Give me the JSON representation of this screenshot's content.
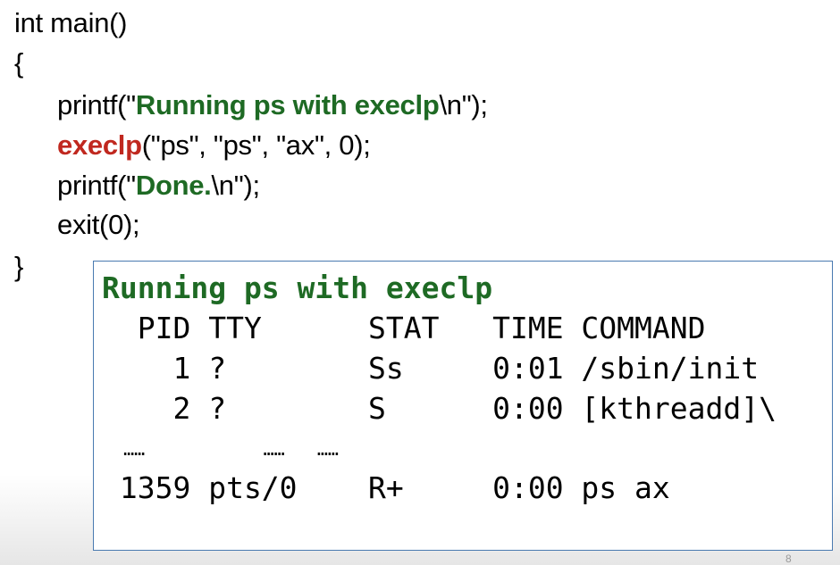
{
  "code": {
    "line1": "int main()",
    "line2": "{",
    "printf1": {
      "prefix": "printf(\"",
      "string": "Running ps with execlp",
      "suffix": "\\n\");"
    },
    "execlp": {
      "keyword": "execlp",
      "args": "(\"ps\", \"ps\", \"ax\", 0);"
    },
    "printf2": {
      "prefix": "printf(\"",
      "string": "Done.",
      "suffix": "\\n\");"
    },
    "exit": "exit(0);",
    "close": "}"
  },
  "terminal": {
    "title": "Running ps with execlp",
    "header": "  PID TTY      STAT   TIME COMMAND",
    "rows": [
      "    1 ?        Ss     0:01 /sbin/init",
      "    2 ?        S      0:00 [kthreadd]\\",
      "  ……           ……   ……",
      " 1359 pts/0    R+     0:00 ps ax"
    ]
  },
  "slide": {
    "page_number": "8"
  },
  "colors": {
    "string": "#1e6a24",
    "keyword": "#c0281f",
    "box_border": "#4a7ab0"
  }
}
